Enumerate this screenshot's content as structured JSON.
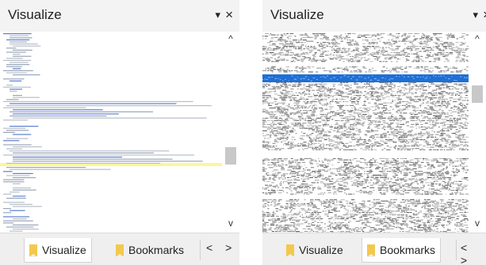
{
  "panels": [
    {
      "title": "Visualize",
      "tab_visualize": "Visualize",
      "tab_bookmarks": "Bookmarks",
      "nav": "< >",
      "scroll_up": "^",
      "scroll_down": "v"
    },
    {
      "title": "Visualize",
      "tab_visualize": "Visualize",
      "tab_bookmarks": "Bookmarks",
      "nav": "< >",
      "scroll_up": "^",
      "scroll_down": "v"
    }
  ],
  "icons": {
    "dropdown": "▾",
    "close": "×",
    "bookmark": "bookmark-icon"
  },
  "colors": {
    "highlight_blue": "#1e6fd6",
    "highlight_yellow": "#fff59a",
    "bookmark_gold": "#f2c94c"
  }
}
